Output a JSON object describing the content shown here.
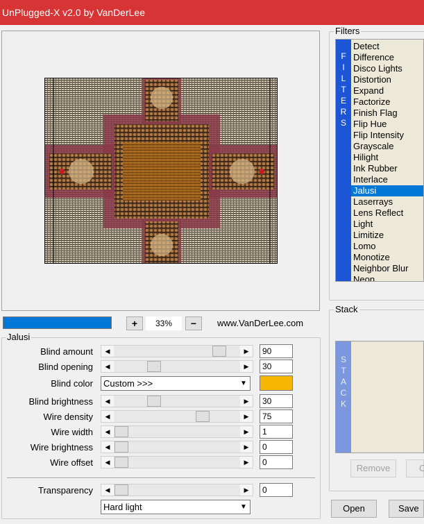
{
  "window": {
    "title": "UnPlugged-X v2.0 by VanDerLee"
  },
  "zoom": {
    "plus_label": "+",
    "minus_label": "−",
    "value": "33%",
    "progress": 1.0
  },
  "website": "www.VanDerLee.com",
  "params_group": {
    "title": "Jalusi",
    "blind_amount": {
      "label": "Blind amount",
      "value": "90"
    },
    "blind_opening": {
      "label": "Blind opening",
      "value": "30"
    },
    "blind_color": {
      "label": "Blind color",
      "selected": "Custom >>>",
      "swatch": "#f5b700"
    },
    "blind_brightness": {
      "label": "Blind brightness",
      "value": "30"
    },
    "wire_density": {
      "label": "Wire density",
      "value": "75"
    },
    "wire_width": {
      "label": "Wire width",
      "value": "1"
    },
    "wire_brightness": {
      "label": "Wire brightness",
      "value": "0"
    },
    "wire_offset": {
      "label": "Wire offset",
      "value": "0"
    },
    "transparency": {
      "label": "Transparency",
      "value": "0"
    },
    "blend_mode": {
      "selected": "Hard light"
    }
  },
  "filters": {
    "title": "Filters",
    "strip_letters": [
      "F",
      "I",
      "L",
      "T",
      "E",
      "R",
      "S"
    ],
    "items": [
      "Detect",
      "Difference",
      "Disco Lights",
      "Distortion",
      "Expand",
      "Factorize",
      "Finish Flag",
      "Flip Hue",
      "Flip Intensity",
      "Grayscale",
      "Hilight",
      "Ink Rubber",
      "Interlace",
      "Jalusi",
      "Laserrays",
      "Lens Reflect",
      "Light",
      "Limitize",
      "Lomo",
      "Monotize",
      "Neighbor Blur",
      "Neon"
    ],
    "selected": "Jalusi"
  },
  "stack": {
    "title": "Stack",
    "strip_letters": [
      "S",
      "T",
      "A",
      "C",
      "K"
    ],
    "remove_label": "Remove",
    "clear_label": "C"
  },
  "buttons": {
    "open": "Open",
    "save": "Save"
  },
  "colors": {
    "titlebar": "#d73535",
    "accent": "#0078d7",
    "filter_strip": "#1c55d6",
    "stack_strip": "#7b97dd"
  }
}
